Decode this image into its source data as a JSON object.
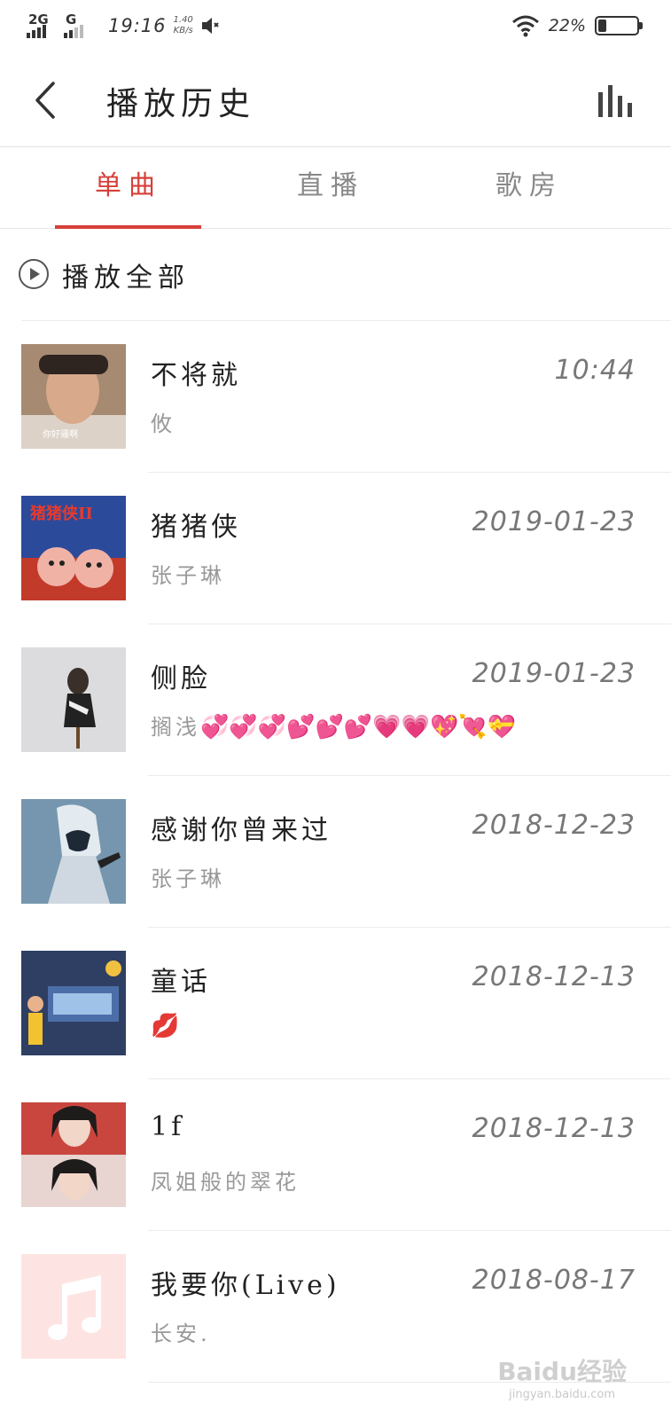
{
  "status_bar": {
    "network_1": "2G",
    "network_2": "G",
    "time": "19:16",
    "speed_value": "1.40",
    "speed_unit": "KB/s",
    "battery_percent": "22%",
    "battery_level": 0.22
  },
  "header": {
    "title": "播放历史",
    "back_icon": "chevron-left-icon",
    "stats_icon": "bar-chart-icon"
  },
  "tabs": [
    {
      "label": "单曲",
      "active": true
    },
    {
      "label": "直播",
      "active": false
    },
    {
      "label": "歌房",
      "active": false
    }
  ],
  "play_all": {
    "label": "播放全部",
    "icon": "play-circle-icon"
  },
  "songs": [
    {
      "title": "不将就",
      "artist": "攸",
      "date": "10:44",
      "cover_label": "你好骚啊",
      "cover_color": "#b07a56"
    },
    {
      "title": "猪猪侠",
      "artist": "张子琳",
      "date": "2019-01-23",
      "cover_label": "猪猪侠II",
      "cover_color": "#2c4a9a"
    },
    {
      "title": "侧脸",
      "artist": "搁浅",
      "artist_emojis": "💞💞💞💕💕💕💗💗💖💘💝",
      "date": "2019-01-23",
      "cover_color": "#d9d9db"
    },
    {
      "title": "感谢你曾来过",
      "artist": "张子琳",
      "date": "2018-12-23",
      "cover_color": "#6f8ea6"
    },
    {
      "title": "童话",
      "artist": "",
      "artist_emojis": "💋",
      "date": "2018-12-13",
      "cover_color": "#3d5a86"
    },
    {
      "title": "1f",
      "artist": "凤姐般的翠花",
      "date": "2018-12-13",
      "cover_color": "#c2524e"
    },
    {
      "title": "我要你(Live)",
      "artist": "长安.",
      "date": "2018-08-17",
      "cover_color": "#fde4e2"
    }
  ],
  "watermark": {
    "logo": "Baidu经验",
    "url": "jingyan.baidu.com"
  },
  "colors": {
    "accent": "#d6403a",
    "text": "#222222",
    "secondary": "#999999"
  }
}
